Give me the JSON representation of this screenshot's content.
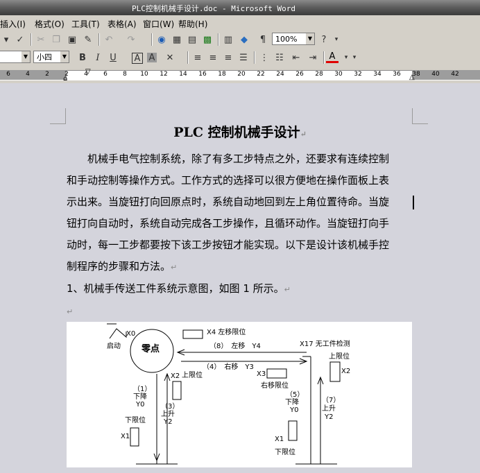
{
  "window": {
    "title": "PLC控制机械手设计.doc - Microsoft Word"
  },
  "menu": [
    "插入(I)",
    "格式(O)",
    "工具(T)",
    "表格(A)",
    "窗口(W)",
    "帮助(H)"
  ],
  "toolbar": {
    "zoom": "100%",
    "font_size": "小四"
  },
  "ruler": {
    "ticks": [
      "6",
      "4",
      "2",
      "2",
      "4",
      "6",
      "8",
      "10",
      "12",
      "14",
      "16",
      "18",
      "20",
      "22",
      "24",
      "26",
      "28",
      "30",
      "32",
      "34",
      "36",
      "38",
      "40",
      "42"
    ]
  },
  "document": {
    "title": "PLC 控制机械手设计",
    "para1_lines": [
      "　　机械手电气控制系统，除了有多工步特点之外，还要求有连续控制",
      "和手动控制等操作方式。工作方式的选择可以很方便地在操作面板上表",
      "示出来。当旋钮打向回原点时，系统自动地回到左上角位置待命。当旋",
      "钮打向自动时，系统自动完成各工步操作，且循环动作。当旋钮打向手",
      "动时，每一工步都要按下该工步按钮才能实现。以下是设计该机械手控",
      "制程序的步骤和方法。"
    ],
    "item1": "1、机械手传送工件系统示意图，如图 1 所示。",
    "paragraph_mark": "↵"
  },
  "figure": {
    "origin": "零点",
    "start": "启动",
    "x0": "X0",
    "x4": "X4 左移限位",
    "step8": "（8）　左移　Y4",
    "x17": "X17 无工件检测",
    "step4": "（4）　右移　Y3",
    "upper_limit_right": "上限位",
    "x2_right": "X2",
    "x3": "X3",
    "right_limit": "右移限位",
    "step5_n": "（5）",
    "step5_t": "下降",
    "step5_y": "Y0",
    "step7_n": "（7）",
    "step7_t": "上升",
    "step7_y": "Y2",
    "step1_n": "（1）",
    "step1_t": "下降",
    "step1_y": "Y0",
    "x2_left": "X2",
    "upper_limit_left": "上限位",
    "step3_n": "（3）",
    "step3_t": "上升",
    "step3_y": "Y2",
    "lower_limit_left": "下限位",
    "x1_left": "X1",
    "x1_right": "X1",
    "lower_limit_right": "下限位"
  }
}
